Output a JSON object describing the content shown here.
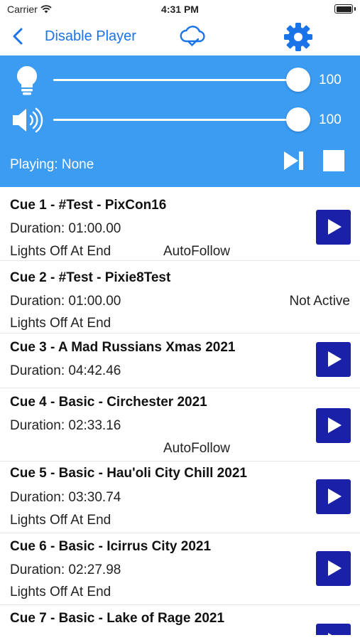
{
  "status_bar": {
    "carrier": "Carrier",
    "time": "4:31 PM"
  },
  "nav": {
    "back_icon": "chevron-left-icon",
    "title": "Disable Player",
    "cloud_icon": "cloud-check-icon",
    "settings_icon": "gear-icon"
  },
  "controls": {
    "brightness": {
      "icon": "lightbulb-icon",
      "value": 100,
      "value_label": "100"
    },
    "volume": {
      "icon": "speaker-icon",
      "value": 100,
      "value_label": "100"
    },
    "playing": "Playing: None",
    "next_icon": "skip-forward-icon",
    "stop_icon": "stop-icon"
  },
  "colors": {
    "accent": "#3b9cf2",
    "nav_text": "#1a73e8",
    "play_button": "#1a21a8"
  },
  "cues": [
    {
      "title": "Cue 1 - #Test - PixCon16",
      "duration": "Duration: 01:00.00",
      "lights_off": "Lights Off At End",
      "autofollow": "AutoFollow",
      "status": "",
      "has_play": true
    },
    {
      "title": "Cue 2 - #Test - Pixie8Test",
      "duration": "Duration: 01:00.00",
      "lights_off": "Lights Off At End",
      "autofollow": "",
      "status": "Not Active",
      "has_play": false
    },
    {
      "title": "Cue 3 - A Mad Russians Xmas 2021",
      "duration": "Duration: 04:42.46",
      "lights_off": "",
      "autofollow": "",
      "status": "",
      "has_play": true
    },
    {
      "title": "Cue 4 - Basic - Circhester 2021",
      "duration": "Duration: 02:33.16",
      "lights_off": "",
      "autofollow": "AutoFollow",
      "status": "",
      "has_play": true
    },
    {
      "title": "Cue 5 - Basic - Hau'oli City Chill 2021",
      "duration": "Duration: 03:30.74",
      "lights_off": "Lights Off At End",
      "autofollow": "",
      "status": "",
      "has_play": true
    },
    {
      "title": "Cue 6 - Basic - Icirrus City 2021",
      "duration": "Duration: 02:27.98",
      "lights_off": "Lights Off At End",
      "autofollow": "",
      "status": "",
      "has_play": true
    },
    {
      "title": "Cue 7 - Basic - Lake of Rage 2021",
      "duration": "",
      "lights_off": "",
      "autofollow": "",
      "status": "",
      "has_play": true
    }
  ]
}
